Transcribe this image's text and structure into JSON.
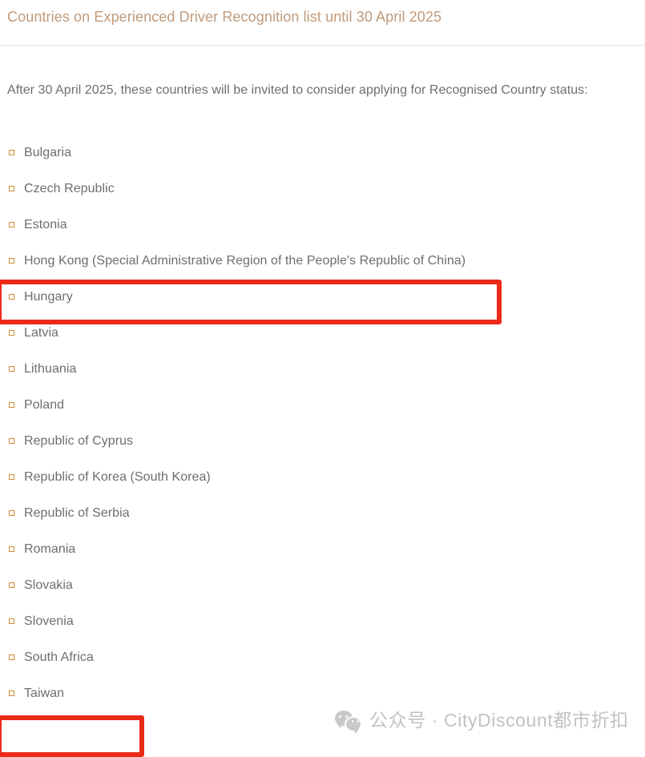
{
  "header": {
    "title": "Countries on Experienced Driver Recognition list until 30 April 2025"
  },
  "main": {
    "intro": "After 30 April 2025, these countries will be invited to consider applying for Recognised Country status:",
    "countries": [
      {
        "label": "Bulgaria",
        "highlighted": false
      },
      {
        "label": "Czech Republic",
        "highlighted": false
      },
      {
        "label": "Estonia",
        "highlighted": false
      },
      {
        "label": "Hong Kong (Special Administrative Region of the People's Republic of China)",
        "highlighted": true
      },
      {
        "label": "Hungary",
        "highlighted": false
      },
      {
        "label": "Latvia",
        "highlighted": false
      },
      {
        "label": "Lithuania",
        "highlighted": false
      },
      {
        "label": "Poland",
        "highlighted": false
      },
      {
        "label": "Republic of Cyprus",
        "highlighted": false
      },
      {
        "label": "Republic of Korea (South Korea)",
        "highlighted": false
      },
      {
        "label": "Republic of Serbia",
        "highlighted": false
      },
      {
        "label": "Romania",
        "highlighted": false
      },
      {
        "label": "Slovakia",
        "highlighted": false
      },
      {
        "label": "Slovenia",
        "highlighted": false
      },
      {
        "label": "South Africa",
        "highlighted": false
      },
      {
        "label": "Taiwan",
        "highlighted": true
      }
    ]
  },
  "watermark": {
    "text": "公众号 · CityDiscount都市折扣"
  },
  "colors": {
    "title_text": "#c09a7b",
    "body_text": "#6e6e6e",
    "bullet_marker": "#cf8a33",
    "highlight_border": "#ec2a1a",
    "watermark_text": "#c2c2c2",
    "divider": "#e6e6e6",
    "background": "#ffffff"
  }
}
